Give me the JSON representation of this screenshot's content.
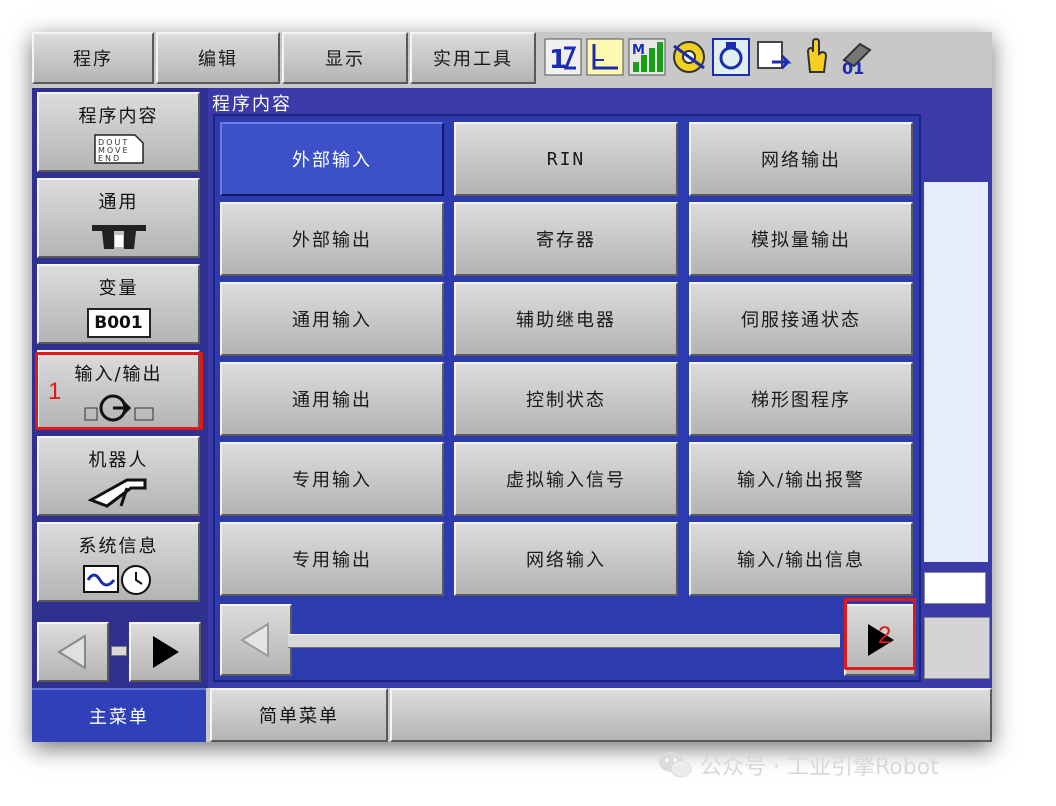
{
  "top_menu": [
    {
      "label": "程序"
    },
    {
      "label": "编辑"
    },
    {
      "label": "显示"
    },
    {
      "label": "实用工具"
    }
  ],
  "status_icons": [
    "coord-icon",
    "frame-icon",
    "speed-icon",
    "servo-icon",
    "tool-icon",
    "mode-icon",
    "hand-icon",
    "cycle-icon"
  ],
  "status_text": {
    "coord": "1",
    "cycle": "01"
  },
  "left_menu": [
    {
      "label": "程序内容",
      "icon_text": "DOUT MOVE END"
    },
    {
      "label": "通用"
    },
    {
      "label": "变量",
      "icon_text": "B001"
    },
    {
      "label": "输入/输出",
      "icon_text": "IN OUT"
    },
    {
      "label": "机器人"
    },
    {
      "label": "系统信息"
    }
  ],
  "background_title": "程序内容",
  "submenu": [
    [
      "外部输入",
      "RIN",
      "网络输出"
    ],
    [
      "外部输出",
      "寄存器",
      "模拟量输出"
    ],
    [
      "通用输入",
      "辅助继电器",
      "伺服接通状态"
    ],
    [
      "通用输出",
      "控制状态",
      "梯形图程序"
    ],
    [
      "专用输入",
      "虚拟输入信号",
      "输入/输出报警"
    ],
    [
      "专用输出",
      "网络输入",
      "输入/输出信息"
    ]
  ],
  "selected_item": "外部输入",
  "annotations": {
    "first": "1",
    "second": "2"
  },
  "bottom_tabs": [
    {
      "label": "主菜单",
      "active": true
    },
    {
      "label": "简单菜单",
      "active": false
    }
  ],
  "watermark": "公众号 · 工业引擎Robot",
  "colors": {
    "panel_blue": "#2c3cae",
    "selected_blue": "#3c50c8",
    "highlight_red": "#e01818",
    "button_grey": "#c8c8c8"
  }
}
